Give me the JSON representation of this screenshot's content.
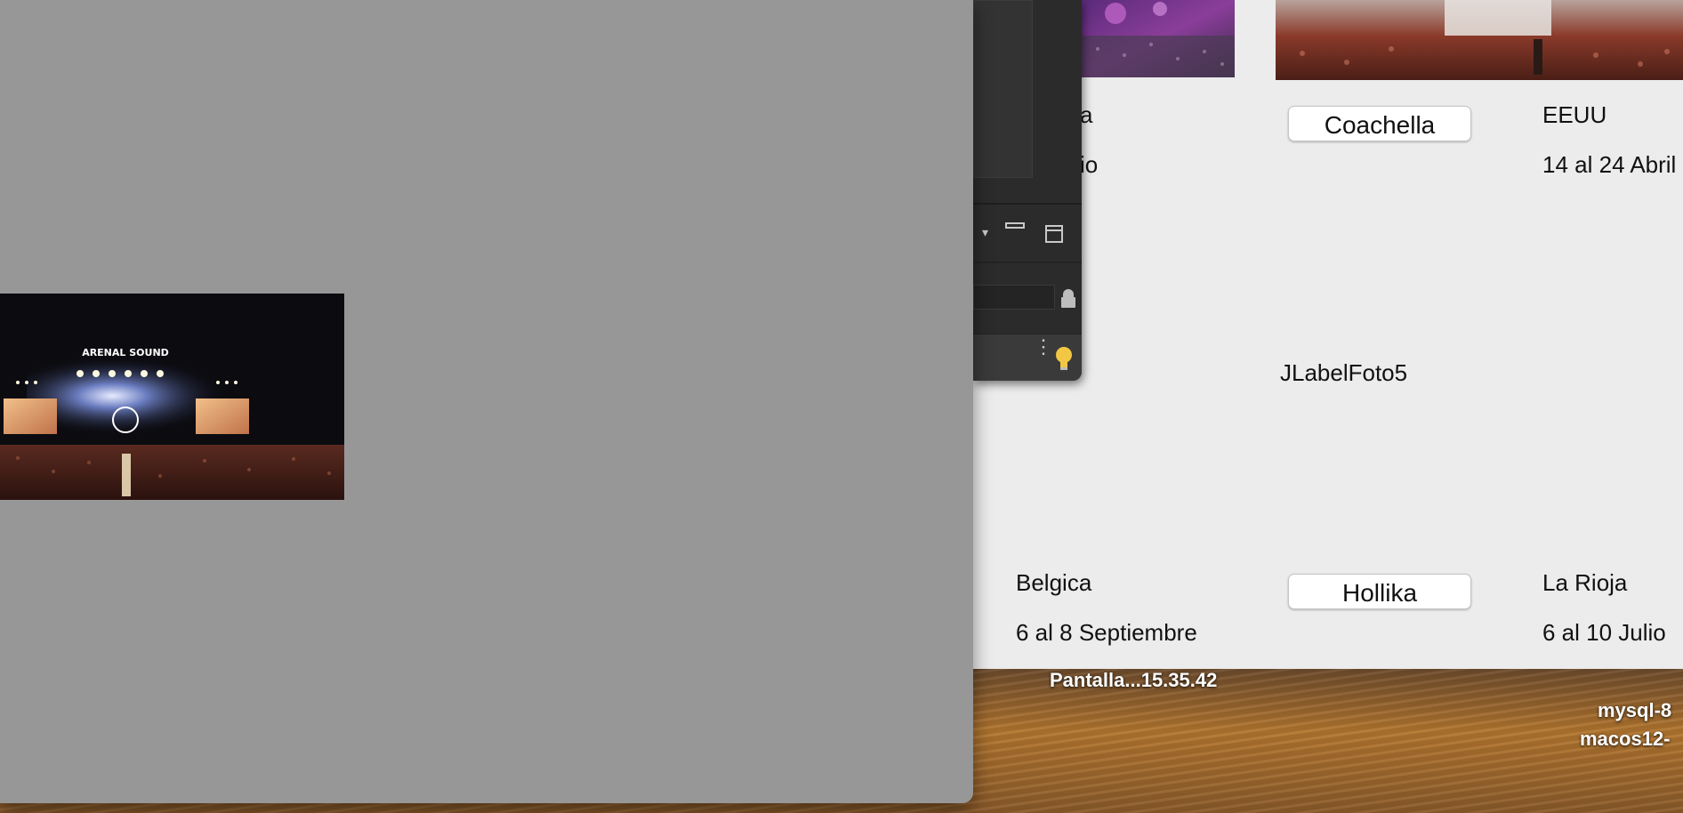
{
  "app": {
    "festivals": [
      {
        "location": "",
        "dates": "",
        "partial_location": "a",
        "partial_dates": "io"
      },
      {
        "name": "Coachella",
        "location": "EEUU",
        "dates": "14 al 24 Abril"
      },
      {
        "placeholder_label": "JLabelFoto5"
      },
      {
        "location": "Belgica",
        "dates": "6 al 8 Septiembre"
      },
      {
        "name": "Hollika",
        "location": "La Rioja",
        "dates": "6 al 10 Julio"
      }
    ]
  },
  "photo": {
    "stage_sign": "ARENAL SOUND"
  },
  "desktop": {
    "screenshot_file": "Pantalla...15.35.42",
    "file_line1": "mysql-8",
    "file_line2": "macos12-"
  },
  "colors": {
    "grey_window": "#979797",
    "app_background": "#ececec",
    "ide_background": "#2b2b2b"
  },
  "icons": [
    "dropdown-arrow-icon",
    "minimize-icon",
    "restore-window-icon",
    "more-options-icon",
    "lightbulb-icon",
    "lock-icon"
  ]
}
